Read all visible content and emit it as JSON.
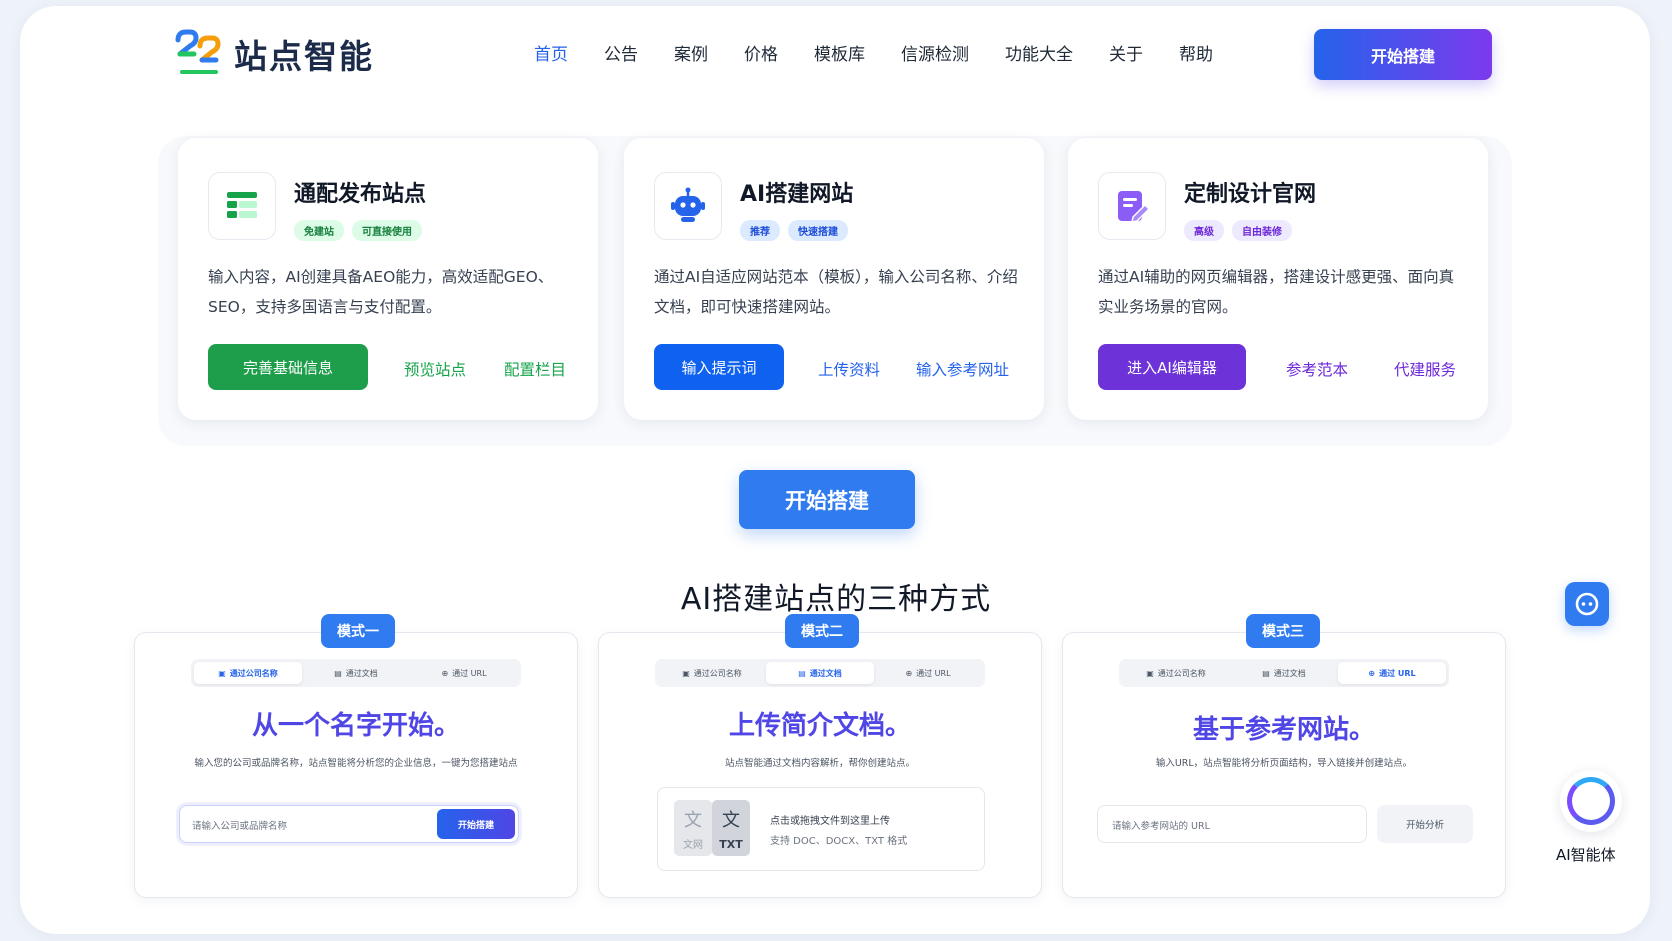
{
  "header": {
    "brand": "站点智能",
    "nav": [
      "首页",
      "公告",
      "案例",
      "价格",
      "模板库",
      "信源检测",
      "功能大全",
      "关于",
      "帮助"
    ],
    "active_index": 0,
    "cta": "开始搭建"
  },
  "cards": [
    {
      "title": "通配发布站点",
      "tags": [
        "免建站",
        "可直接使用"
      ],
      "desc": "输入内容，AI创建具备AEO能力，高效适配GEO、SEO，支持多国语言与支付配置。",
      "primary": "完善基础信息",
      "links": [
        "预览站点",
        "配置栏目"
      ],
      "accent": "#16a34a"
    },
    {
      "title": "AI搭建网站",
      "tags": [
        "推荐",
        "快速搭建"
      ],
      "desc": "通过AI自适应网站范本（模板），输入公司名称、介绍文档，即可快速搭建网站。",
      "primary": "输入提示词",
      "links": [
        "上传资料",
        "输入参考网址"
      ],
      "accent": "#2563eb"
    },
    {
      "title": "定制设计官网",
      "tags": [
        "高级",
        "自由装修"
      ],
      "desc": "通过AI辅助的网页编辑器，搭建设计感更强、面向真实业务场景的官网。",
      "primary": "进入AI编辑器",
      "links": [
        "参考范本",
        "代建服务"
      ],
      "accent": "#6d28d9"
    }
  ],
  "middle": {
    "cta": "开始搭建",
    "section_title": "AI搭建站点的三种方式"
  },
  "modes": [
    {
      "badge": "模式一",
      "tabs": [
        "通过公司名称",
        "通过文档",
        "通过 URL"
      ],
      "active_tab": 0,
      "headline": "从一个名字开始。",
      "sub": "输入您的公司或品牌名称，站点智能将分析您的企业信息，一键为您搭建站点",
      "placeholder": "请输入公司或品牌名称",
      "button": "开始搭建"
    },
    {
      "badge": "模式二",
      "tabs": [
        "通过公司名称",
        "通过文档",
        "通过 URL"
      ],
      "active_tab": 1,
      "headline": "上传简介文档。",
      "sub": "站点智能通过文档内容解析，帮你创建站点。",
      "upload_line1": "点击或拖拽文件到这里上传",
      "upload_line2": "支持 DOC、DOCX、TXT 格式",
      "doc_label": "文网",
      "txt_label": "TXT"
    },
    {
      "badge": "模式三",
      "tabs": [
        "通过公司名称",
        "通过文档",
        "通过 URL"
      ],
      "active_tab": 2,
      "headline": "基于参考网站。",
      "sub": "输入URL，站点智能将分析页面结构，导入链接并创建站点。",
      "placeholder": "请输入参考网站的 URL",
      "button": "开始分析"
    }
  ],
  "floating": {
    "agent_label": "AI智能体"
  },
  "icons": [
    "logo-mark",
    "table-icon",
    "robot-icon",
    "edit-doc-icon",
    "building-icon",
    "file-icon",
    "globe-icon",
    "chat-bot-icon",
    "agent-ring-icon"
  ]
}
